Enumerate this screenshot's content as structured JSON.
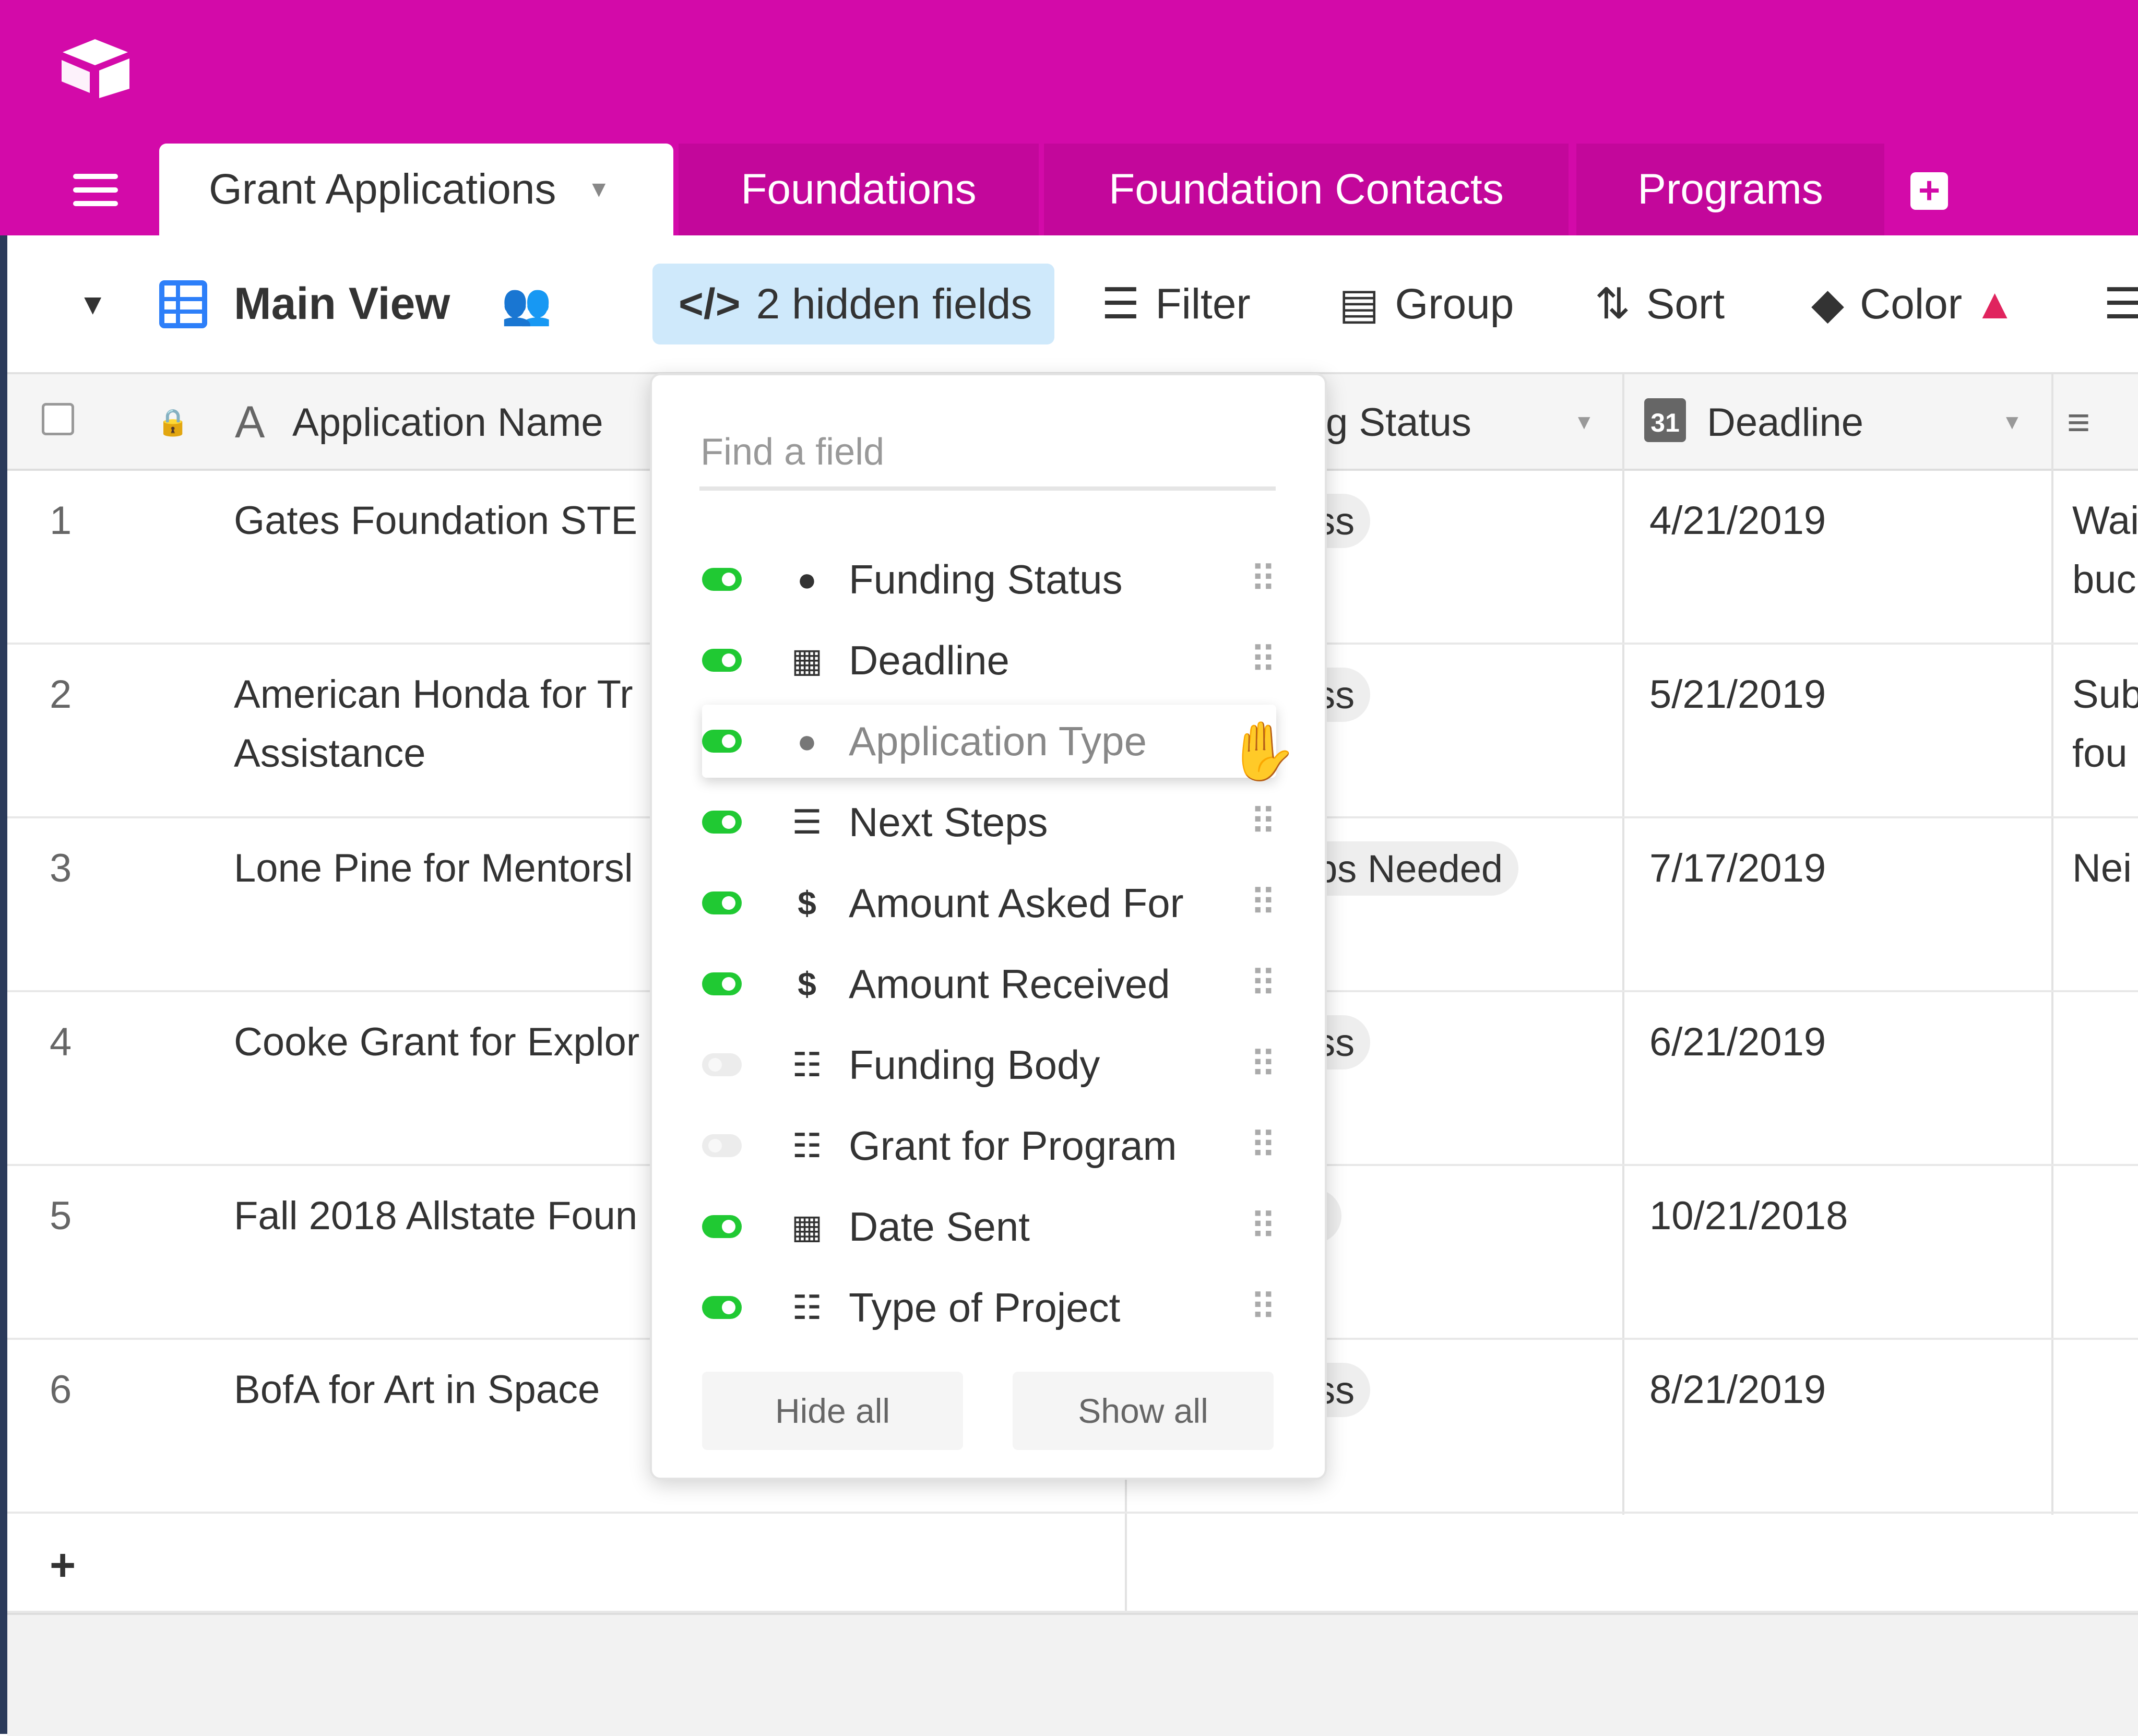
{
  "brand": {
    "accent": "#d30aa9",
    "toggle_on": "#20c933"
  },
  "tabs": {
    "active": "Grant Applications",
    "others": [
      "Foundations",
      "Foundation Contacts",
      "Programs"
    ],
    "add_icon": "plus-square-icon"
  },
  "toolbar": {
    "view_name": "Main View",
    "hidden_fields": "2 hidden fields",
    "filter": "Filter",
    "group": "Group",
    "sort": "Sort",
    "color": "Color"
  },
  "grid": {
    "headers": {
      "application_name": "Application Name",
      "status_partial": "g Status",
      "deadline": "Deadline",
      "deadline_icon_text": "31"
    },
    "rows": [
      {
        "num": "1",
        "name": "Gates Foundation STE",
        "status": "ess",
        "date": "4/21/2019",
        "notes": [
          "Wai",
          "buc"
        ]
      },
      {
        "num": "2",
        "name": "American Honda for Tr",
        "name2": "Assistance",
        "status": "ess",
        "date": "5/21/2019",
        "notes": [
          "Sub",
          "fou"
        ]
      },
      {
        "num": "3",
        "name": "Lone Pine for Mentorsl",
        "status": "eps Needed",
        "date": "7/17/2019",
        "notes": [
          "Nei"
        ]
      },
      {
        "num": "4",
        "name": "Cooke Grant for Explor",
        "status": "ess",
        "date": "6/21/2019",
        "notes": []
      },
      {
        "num": "5",
        "name": "Fall 2018 Allstate Foun",
        "status": "",
        "date": "10/21/2018",
        "notes": []
      },
      {
        "num": "6",
        "name": "BofA for Art in Space",
        "status": "ess",
        "date": "8/21/2019",
        "notes": []
      }
    ],
    "add_row": "+"
  },
  "popover": {
    "search_placeholder": "Find a field",
    "fields": [
      {
        "label": "Funding Status",
        "icon": "single-select-icon",
        "on": true
      },
      {
        "label": "Deadline",
        "icon": "calendar-icon",
        "on": true
      },
      {
        "label": "Application Type",
        "icon": "single-select-icon",
        "on": true
      },
      {
        "label": "Next Steps",
        "icon": "long-text-icon",
        "on": true
      },
      {
        "label": "Amount Asked For",
        "icon": "currency-icon",
        "on": true
      },
      {
        "label": "Amount Received",
        "icon": "currency-icon",
        "on": true
      },
      {
        "label": "Funding Body",
        "icon": "link-icon",
        "on": false
      },
      {
        "label": "Grant for Program",
        "icon": "link-icon",
        "on": false
      },
      {
        "label": "Date Sent",
        "icon": "calendar-icon",
        "on": true
      },
      {
        "label": "Type of Project",
        "icon": "multi-select-icon",
        "on": true
      }
    ],
    "hide_all": "Hide all",
    "show_all": "Show all"
  }
}
